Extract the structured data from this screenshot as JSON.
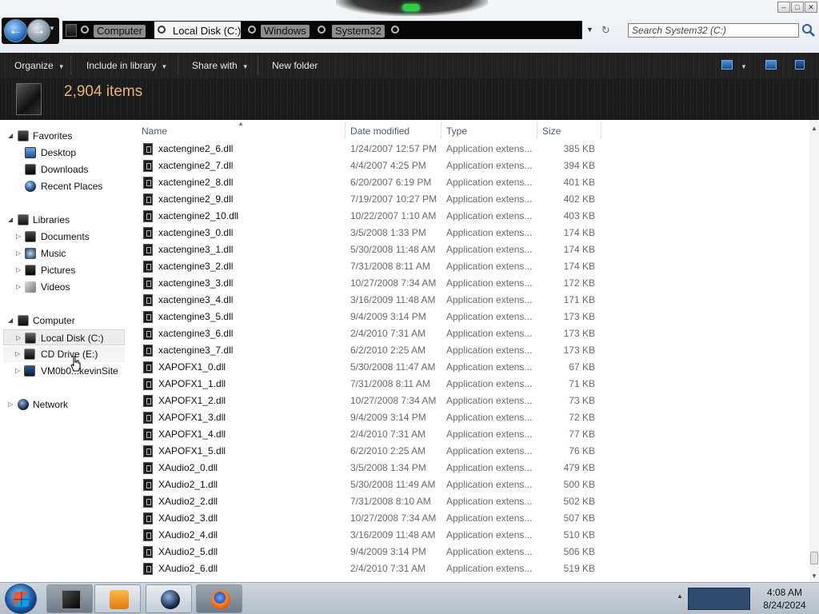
{
  "window": {
    "address": {
      "crumbs": [
        "Computer",
        "Local Disk (C:)",
        "Windows",
        "System32"
      ]
    },
    "search_placeholder": "Search System32 (C:)",
    "controls": {
      "minimize": "–",
      "maximize": "□",
      "close": "✕"
    }
  },
  "toolbar": {
    "organize": "Organize",
    "include_in_library": "Include in library",
    "share_with": "Share with",
    "new_folder": "New folder"
  },
  "info": {
    "item_count": "2,904 items"
  },
  "navigation": {
    "favorites": {
      "label": "Favorites",
      "items": [
        "Desktop",
        "Downloads",
        "Recent Places"
      ]
    },
    "libraries": {
      "label": "Libraries",
      "items": [
        "Documents",
        "Music",
        "Pictures",
        "Videos"
      ]
    },
    "computer": {
      "label": "Computer",
      "items": [
        "Local Disk (C:)",
        "CD Drive (E:)",
        "VM0b0...kevinSite"
      ]
    },
    "network": {
      "label": "Network"
    }
  },
  "columns": {
    "name": "Name",
    "date_modified": "Date modified",
    "type": "Type",
    "size": "Size"
  },
  "files": [
    {
      "name": "xactengine2_6.dll",
      "date": "1/24/2007 12:57 PM",
      "type": "Application extens...",
      "size": "385 KB"
    },
    {
      "name": "xactengine2_7.dll",
      "date": "4/4/2007 4:25 PM",
      "type": "Application extens...",
      "size": "394 KB"
    },
    {
      "name": "xactengine2_8.dll",
      "date": "6/20/2007 6:19 PM",
      "type": "Application extens...",
      "size": "401 KB"
    },
    {
      "name": "xactengine2_9.dll",
      "date": "7/19/2007 10:27 PM",
      "type": "Application extens...",
      "size": "402 KB"
    },
    {
      "name": "xactengine2_10.dll",
      "date": "10/22/2007 1:10 AM",
      "type": "Application extens...",
      "size": "403 KB"
    },
    {
      "name": "xactengine3_0.dll",
      "date": "3/5/2008 1:33 PM",
      "type": "Application extens...",
      "size": "174 KB"
    },
    {
      "name": "xactengine3_1.dll",
      "date": "5/30/2008 11:48 AM",
      "type": "Application extens...",
      "size": "174 KB"
    },
    {
      "name": "xactengine3_2.dll",
      "date": "7/31/2008 8:11 AM",
      "type": "Application extens...",
      "size": "174 KB"
    },
    {
      "name": "xactengine3_3.dll",
      "date": "10/27/2008 7:34 AM",
      "type": "Application extens...",
      "size": "172 KB"
    },
    {
      "name": "xactengine3_4.dll",
      "date": "3/16/2009 11:48 AM",
      "type": "Application extens...",
      "size": "171 KB"
    },
    {
      "name": "xactengine3_5.dll",
      "date": "9/4/2009 3:14 PM",
      "type": "Application extens...",
      "size": "173 KB"
    },
    {
      "name": "xactengine3_6.dll",
      "date": "2/4/2010 7:31 AM",
      "type": "Application extens...",
      "size": "173 KB"
    },
    {
      "name": "xactengine3_7.dll",
      "date": "6/2/2010 2:25 AM",
      "type": "Application extens...",
      "size": "173 KB"
    },
    {
      "name": "XAPOFX1_0.dll",
      "date": "5/30/2008 11:47 AM",
      "type": "Application extens...",
      "size": "67 KB"
    },
    {
      "name": "XAPOFX1_1.dll",
      "date": "7/31/2008 8:11 AM",
      "type": "Application extens...",
      "size": "71 KB"
    },
    {
      "name": "XAPOFX1_2.dll",
      "date": "10/27/2008 7:34 AM",
      "type": "Application extens...",
      "size": "73 KB"
    },
    {
      "name": "XAPOFX1_3.dll",
      "date": "9/4/2009 3:14 PM",
      "type": "Application extens...",
      "size": "72 KB"
    },
    {
      "name": "XAPOFX1_4.dll",
      "date": "2/4/2010 7:31 AM",
      "type": "Application extens...",
      "size": "77 KB"
    },
    {
      "name": "XAPOFX1_5.dll",
      "date": "6/2/2010 2:25 AM",
      "type": "Application extens...",
      "size": "76 KB"
    },
    {
      "name": "XAudio2_0.dll",
      "date": "3/5/2008 1:34 PM",
      "type": "Application extens...",
      "size": "479 KB"
    },
    {
      "name": "XAudio2_1.dll",
      "date": "5/30/2008 11:49 AM",
      "type": "Application extens...",
      "size": "500 KB"
    },
    {
      "name": "XAudio2_2.dll",
      "date": "7/31/2008 8:10 AM",
      "type": "Application extens...",
      "size": "502 KB"
    },
    {
      "name": "XAudio2_3.dll",
      "date": "10/27/2008 7:34 AM",
      "type": "Application extens...",
      "size": "507 KB"
    },
    {
      "name": "XAudio2_4.dll",
      "date": "3/16/2009 11:48 AM",
      "type": "Application extens...",
      "size": "510 KB"
    },
    {
      "name": "XAudio2_5.dll",
      "date": "9/4/2009 3:14 PM",
      "type": "Application extens...",
      "size": "506 KB"
    },
    {
      "name": "XAudio2_6.dll",
      "date": "2/4/2010 7:31 AM",
      "type": "Application extens...",
      "size": "519 KB"
    }
  ],
  "taskbar": {
    "clock_time": "4:08 AM",
    "clock_date": "8/24/2024",
    "pinned": [
      "explorer-icon",
      "media-player-icon",
      "network-globe-icon",
      "firefox-icon"
    ]
  },
  "icons": {
    "back": "back-arrow-icon",
    "forward": "forward-arrow-icon",
    "search": "search-icon",
    "refresh": "refresh-icon"
  },
  "colors": {
    "accent_count": "#e9b27a",
    "toolbar_bg": "#1e1e1e",
    "column_header": "#4a5a75"
  }
}
